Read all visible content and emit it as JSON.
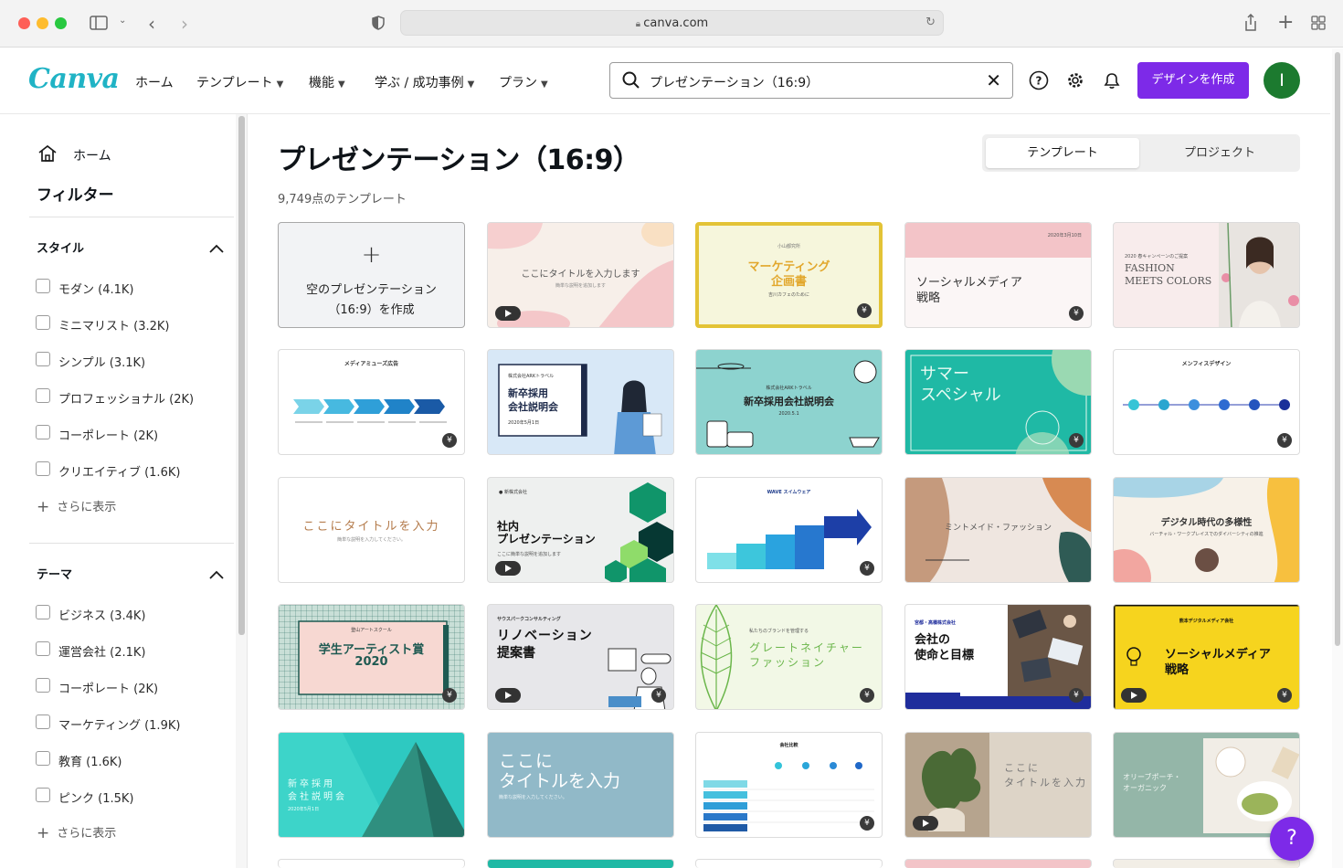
{
  "browser": {
    "url": "canva.com"
  },
  "header": {
    "logo": "Canva",
    "nav": [
      {
        "label": "ホーム",
        "has_chevron": false
      },
      {
        "label": "テンプレート",
        "has_chevron": true
      },
      {
        "label": "機能",
        "has_chevron": true
      },
      {
        "label": "学ぶ / 成功事例",
        "has_chevron": true
      },
      {
        "label": "プラン",
        "has_chevron": true
      }
    ],
    "search_value": "プレゼンテーション（16:9）",
    "create_button": "デザインを作成",
    "avatar_letter": "I",
    "accent": "#7d2ae8"
  },
  "sidebar": {
    "home": "ホーム",
    "filter_title": "フィルター",
    "style": {
      "title": "スタイル",
      "items": [
        "モダン (4.1K)",
        "ミニマリスト (3.2K)",
        "シンプル (3.1K)",
        "プロフェッショナル (2K)",
        "コーポレート (2K)",
        "クリエイティブ (1.6K)"
      ],
      "show_more": "さらに表示"
    },
    "theme": {
      "title": "テーマ",
      "items": [
        "ビジネス (3.4K)",
        "運営会社 (2.1K)",
        "コーポレート (2K)",
        "マーケティング (1.9K)",
        "教育 (1.6K)",
        "ピンク (1.5K)"
      ],
      "show_more": "さらに表示"
    }
  },
  "main": {
    "title": "プレゼンテーション（16:9）",
    "count": "9,749点のテンプレート",
    "toggle": {
      "templates": "テンプレート",
      "projects": "プロジェクト"
    },
    "blank": {
      "plus": "+",
      "line1": "空のプレゼンテーション",
      "line2": "（16:9）を作成"
    },
    "cards": {
      "c1": {
        "text": "ここにタイトルを入力します",
        "sub": "簡単な説明を追加します"
      },
      "c2": {
        "top": "小山都究所",
        "line1": "マーケティング",
        "line2": "企画書",
        "sub": "吉川カフェのために"
      },
      "c3": {
        "date": "2020年3月10日",
        "line1": "ソーシャルメディア",
        "line2": "戦略"
      },
      "c4": {
        "line1": "FASHION",
        "line2": "MEETS COLORS",
        "top": "2020 春キャンペーンのご提案"
      },
      "c5": {
        "title": "メディアミューズ広告"
      },
      "c6": {
        "top": "株式会社ARKトラベル",
        "line1": "新卒採用",
        "line2": "会社説明会",
        "date": "2020年5月1日"
      },
      "c7": {
        "top": "株式会社ARKトラベル",
        "line1": "新卒採用会社説明会",
        "date": "2020.5.1"
      },
      "c8": {
        "line1": "サマー",
        "line2": "スペシャル"
      },
      "c9": {
        "title": "メンフィスデザイン"
      },
      "c10": {
        "line1": "ここにタイトルを入力",
        "sub": "簡単な説明を入力してください。"
      },
      "c11": {
        "line1": "社内",
        "line2": "プレゼンテーション",
        "sub": "ここに簡単な説明を追加します"
      },
      "c12": {
        "title": "WAVE スイムウェア"
      },
      "c13": {
        "line1": "ミントメイド・ファッション"
      },
      "c14": {
        "line1": "デジタル時代の多様性",
        "sub": "バーチャル・ワークプレイスでのダイバーシティの推進"
      },
      "c15": {
        "top": "登山アートスクール",
        "line1": "学生アーティスト賞",
        "line2": "2020"
      },
      "c16": {
        "top": "サウスパークコンサルティング",
        "line1": "リノベーション",
        "line2": "提案書"
      },
      "c17": {
        "top": "私たちのブランドを管理する",
        "line1": "グレートネイチャー",
        "line2": "ファッション"
      },
      "c18": {
        "top": "宮都・高橋株式会社",
        "line1": "会社の",
        "line2": "使命と目標"
      },
      "c19": {
        "top": "熊本デジタルメディア会社",
        "line1": "ソーシャルメディア",
        "line2": "戦略"
      },
      "c20": {
        "line1": "新卒採用",
        "line2": "会社説明会",
        "date": "2020年5月1日"
      },
      "c21": {
        "line1": "ここに",
        "line2": "タイトルを入力",
        "sub": "簡単な説明を入力してください。"
      },
      "c22": {
        "title": "会社比較"
      },
      "c23": {
        "line1": "ここに",
        "line2": "タイトルを入力"
      },
      "c24": {
        "line1": "オリーブポーチ・",
        "line2": "オーガニック"
      }
    }
  },
  "help": "?"
}
